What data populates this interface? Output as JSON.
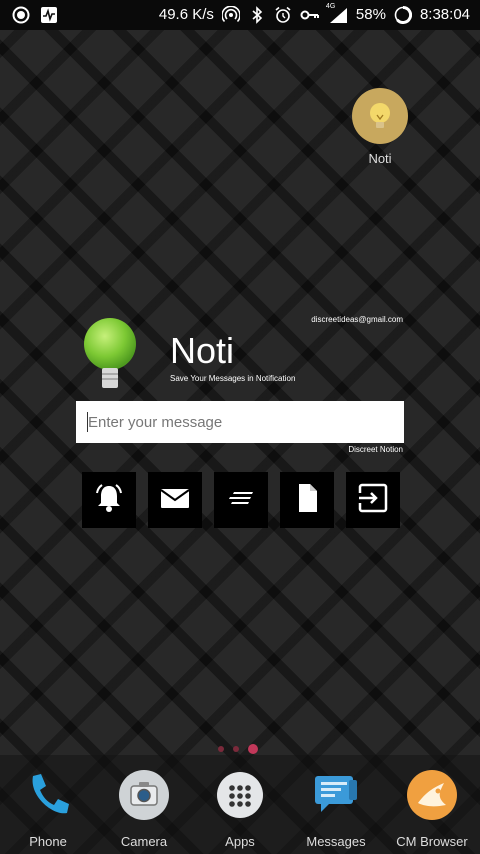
{
  "status_bar": {
    "speed": "49.6 K/s",
    "network_badge": "4G",
    "battery": "58%",
    "time": "8:38:04"
  },
  "desktop_app": {
    "label": "Noti",
    "icon": "lightbulb-icon"
  },
  "widget": {
    "email": "discreetideas@gmail.com",
    "title": "Noti",
    "subtitle": "Save Your Messages in Notification",
    "input_placeholder": "Enter your message",
    "footer": "Discreet Notion",
    "actions": [
      "bell-icon",
      "mail-icon",
      "list-icon",
      "file-icon",
      "exit-icon"
    ]
  },
  "page_indicator": {
    "count": 3,
    "active_index": 2
  },
  "dock": {
    "items": [
      {
        "label": "Phone",
        "icon": "phone-icon"
      },
      {
        "label": "Camera",
        "icon": "camera-icon"
      },
      {
        "label": "Apps",
        "icon": "apps-grid-icon"
      },
      {
        "label": "Messages",
        "icon": "messages-icon"
      },
      {
        "label": "CM Browser",
        "icon": "browser-icon"
      }
    ]
  }
}
